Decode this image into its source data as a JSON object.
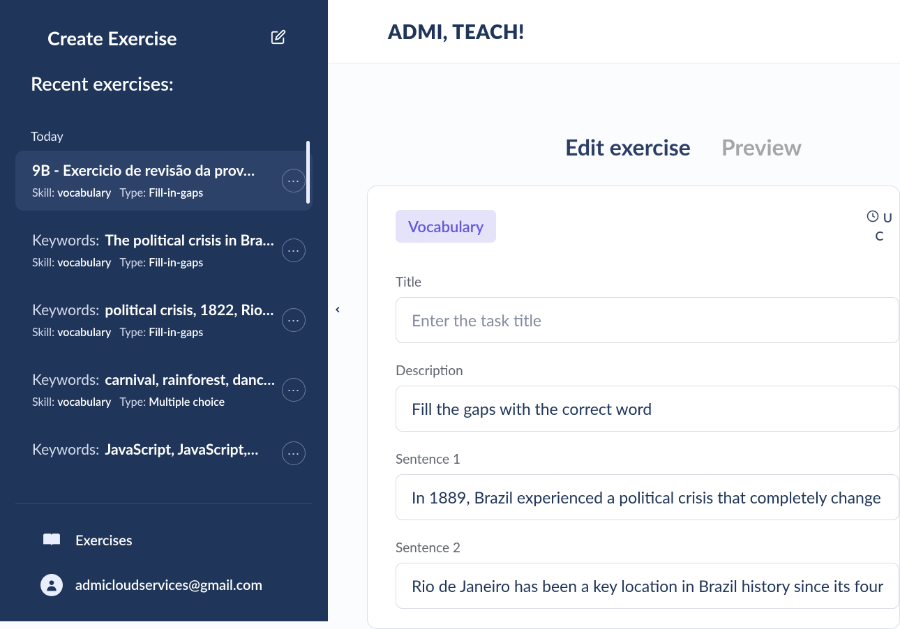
{
  "sidebar": {
    "create_label": "Create Exercise",
    "recent_label": "Recent exercises:",
    "today_label": "Today",
    "items": [
      {
        "title": "9B - Exercicio de revisão da prov…",
        "skill_label": "Skill:",
        "skill_value": "vocabulary",
        "type_label": "Type:",
        "type_value": "Fill-in-gaps",
        "active": true
      },
      {
        "keywords_label": "Keywords:",
        "keywords_value": "The political crisis in Brazil…",
        "skill_label": "Skill:",
        "skill_value": "vocabulary",
        "type_label": "Type:",
        "type_value": "Fill-in-gaps"
      },
      {
        "keywords_label": "Keywords:",
        "keywords_value": "political crisis, 1822, Rio de…",
        "skill_label": "Skill:",
        "skill_value": "vocabulary",
        "type_label": "Type:",
        "type_value": "Fill-in-gaps"
      },
      {
        "keywords_label": "Keywords:",
        "keywords_value": "carnival, rainforest, dance,…",
        "skill_label": "Skill:",
        "skill_value": "vocabulary",
        "type_label": "Type:",
        "type_value": "Multiple choice"
      },
      {
        "keywords_label": "Keywords:",
        "keywords_value": "JavaScript, JavaScript,…"
      }
    ],
    "footer": {
      "exercises_label": "Exercises",
      "user_email": "admicloudservices@gmail.com"
    }
  },
  "brand": "ADMI, TEACH!",
  "tabs": {
    "edit": "Edit exercise",
    "preview": "Preview"
  },
  "panel": {
    "badge": "Vocabulary",
    "clock_text_top": "U",
    "clock_text_bottom": "C",
    "title_label": "Title",
    "title_placeholder": "Enter the task title",
    "title_value": "",
    "description_label": "Description",
    "description_value": "Fill the gaps with the correct word",
    "sentence1_label": "Sentence 1",
    "sentence1_value": "In 1889, Brazil experienced a political crisis that completely change",
    "sentence2_label": "Sentence 2",
    "sentence2_value": "Rio de Janeiro has been a key location in Brazil history since its four"
  }
}
